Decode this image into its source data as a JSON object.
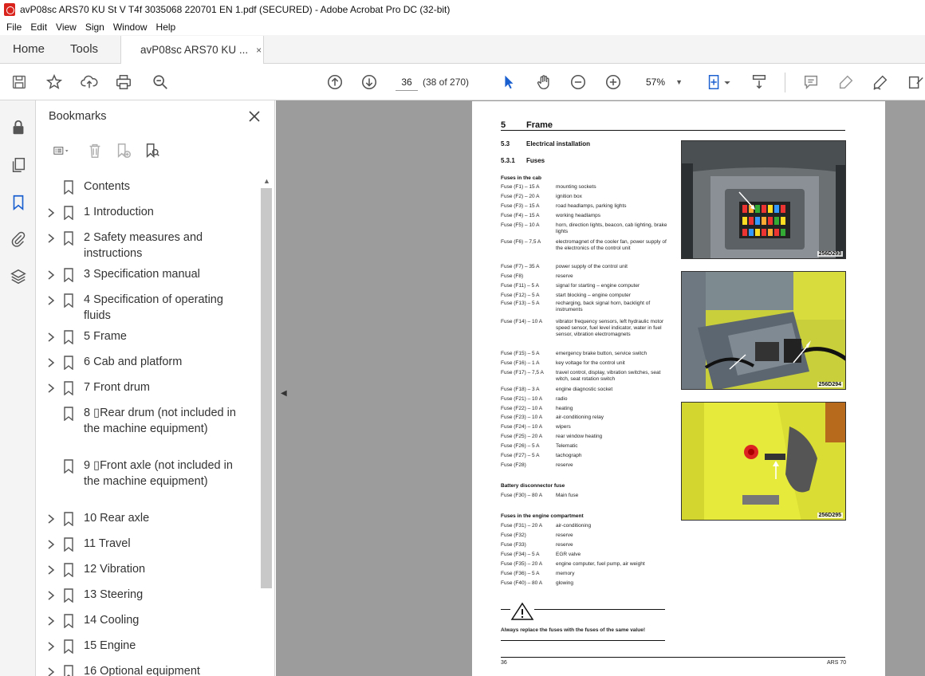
{
  "window": {
    "title": "avP08sc ARS70 KU St V T4f 3035068 220701 EN 1.pdf (SECURED) - Adobe Acrobat Pro DC (32-bit)"
  },
  "menu": [
    "File",
    "Edit",
    "View",
    "Sign",
    "Window",
    "Help"
  ],
  "tabs": {
    "home": "Home",
    "tools": "Tools",
    "doc": "avP08sc ARS70 KU ...",
    "close": "×"
  },
  "toolbar": {
    "page_number": "36",
    "page_of": "(38 of 270)",
    "zoom": "57%",
    "icons": [
      "save-icon",
      "bookmark-star-icon",
      "upload-icon",
      "print-icon",
      "search-zoom-icon",
      "prev-page-icon",
      "next-page-icon",
      "select-cursor-icon",
      "hand-icon",
      "zoom-out-icon",
      "zoom-in-icon",
      "fit-page-icon",
      "scroll-mode-icon",
      "comment-icon",
      "highlight-icon",
      "sign-icon",
      "edit-icon"
    ]
  },
  "rail": {
    "icons": [
      "lock-icon",
      "pages-icon",
      "bookmarks-icon",
      "attachment-icon",
      "layers-icon"
    ]
  },
  "panel": {
    "title": "Bookmarks",
    "close": "×",
    "bookmarks": [
      {
        "label": "Contents",
        "expandable": false
      },
      {
        "label": "1 Introduction",
        "expandable": true
      },
      {
        "label": "2 Safety measures and instructions",
        "expandable": true
      },
      {
        "label": "3 Specification manual",
        "expandable": true
      },
      {
        "label": "4 Specification of operating fluids",
        "expandable": true
      },
      {
        "label": "5 Frame",
        "expandable": true
      },
      {
        "label": "6 Cab and platform",
        "expandable": true
      },
      {
        "label": "7 Front drum",
        "expandable": true
      },
      {
        "label": "8 ▯Rear drum (not included in the machine equipment)",
        "expandable": false
      },
      {
        "label": "9 ▯Front axle (not included in the machine equipment)",
        "expandable": false
      },
      {
        "label": "10 Rear axle",
        "expandable": true
      },
      {
        "label": "11 Travel",
        "expandable": true
      },
      {
        "label": "12 Vibration",
        "expandable": true
      },
      {
        "label": "13 Steering",
        "expandable": true
      },
      {
        "label": "14 Cooling",
        "expandable": true
      },
      {
        "label": "15 Engine",
        "expandable": true
      },
      {
        "label": "16 Optional equipment",
        "expandable": true
      }
    ]
  },
  "document": {
    "chapter_num": "5",
    "chapter": "Frame",
    "section_num": "5.3",
    "section": "Electrical installation",
    "subsection_num": "5.3.1",
    "subsection": "Fuses",
    "cab_heading": "Fuses in the cab",
    "cab_fuses": [
      {
        "id": "Fuse (F1) – 15 A",
        "desc": "mounting sockets"
      },
      {
        "id": "Fuse (F2) – 20 A",
        "desc": "ignition box"
      },
      {
        "id": "Fuse (F3) – 15 A",
        "desc": "road headlamps, parking lights"
      },
      {
        "id": "Fuse (F4) – 15 A",
        "desc": "working headlamps"
      },
      {
        "id": "Fuse (F5) – 10 A",
        "desc": "horn, direction lights, beacon, cab lighting, brake lights"
      },
      {
        "id": "Fuse (F6) – 7,5 A",
        "desc": "electromagnet of the cooler fan, power supply of the electronics of the control unit"
      },
      {
        "id": "Fuse (F7) – 35 A",
        "desc": "power supply of the control unit"
      },
      {
        "id": "Fuse (F8)",
        "desc": "reserve"
      },
      {
        "id": "Fuse (F11) – 5 A",
        "desc": "signal for starting – engine computer"
      },
      {
        "id": "Fuse (F12) – 5 A",
        "desc": "start blocking – engine computer"
      },
      {
        "id": "Fuse (F13) – 5 A",
        "desc": "recharging, back signal horn, backlight of instruments"
      },
      {
        "id": "Fuse (F14) – 10 A",
        "desc": "vibrator frequency sensors, left hydraulic motor speed sensor, fuel level indicator, water in fuel sensor, vibration electromagnets"
      },
      {
        "id": "Fuse (F15) – 5 A",
        "desc": "emergency brake button, service switch"
      },
      {
        "id": "Fuse (F16) – 1 A",
        "desc": "key voltage for the control unit"
      },
      {
        "id": "Fuse (F17) – 7,5 A",
        "desc": "travel control, display, vibration switches, seat witch, seat rotation switch"
      },
      {
        "id": "Fuse (F18) – 3 A",
        "desc": "engine diagnostic socket"
      },
      {
        "id": "Fuse (F21) – 10 A",
        "desc": "radio"
      },
      {
        "id": "Fuse (F22) – 10 A",
        "desc": "heating"
      },
      {
        "id": "Fuse (F23) – 10 A",
        "desc": "air-conditioning relay"
      },
      {
        "id": "Fuse (F24) – 10 A",
        "desc": "wipers"
      },
      {
        "id": "Fuse (F25) – 20 A",
        "desc": "rear window heating"
      },
      {
        "id": "Fuse (F26) – 5 A",
        "desc": "Telematic"
      },
      {
        "id": "Fuse (F27) – 5 A",
        "desc": "tachograph"
      },
      {
        "id": "Fuse (F28)",
        "desc": "reserve"
      }
    ],
    "battery_heading": "Battery disconnector fuse",
    "battery_fuses": [
      {
        "id": "Fuse (F30) – 80 A",
        "desc": "Main fuse"
      }
    ],
    "engine_heading": "Fuses in the engine compartment",
    "engine_fuses": [
      {
        "id": "Fuse (F31) – 20 A",
        "desc": "air-conditioning"
      },
      {
        "id": "Fuse (F32)",
        "desc": "reserve"
      },
      {
        "id": "Fuse (F33)",
        "desc": "reserve"
      },
      {
        "id": "Fuse (F34) – 5 A",
        "desc": "EGR valve"
      },
      {
        "id": "Fuse (F35) – 20 A",
        "desc": "engine computer, fuel pump, air weight"
      },
      {
        "id": "Fuse (F36) – 5 A",
        "desc": "memory"
      },
      {
        "id": "Fuse (F40) – 80 A",
        "desc": "glowing"
      }
    ],
    "photos": [
      {
        "code": "256D293"
      },
      {
        "code": "256D294"
      },
      {
        "code": "256D295"
      }
    ],
    "warning": "Always replace the fuses with the fuses of the same value!",
    "footer_left": "36",
    "footer_right": "ARS 70"
  }
}
